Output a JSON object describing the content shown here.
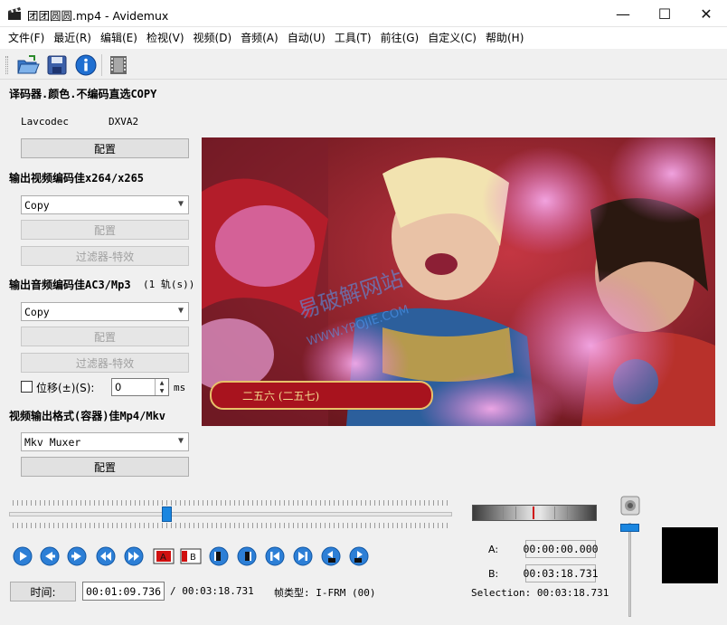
{
  "window": {
    "title": "团团圆圆.mp4 - Avidemux",
    "minimize": "—",
    "maximize": "☐",
    "close": "✕"
  },
  "menu": [
    "文件(F)",
    "最近(R)",
    "编辑(E)",
    "检视(V)",
    "视频(D)",
    "音频(A)",
    "自动(U)",
    "工具(T)",
    "前往(G)",
    "自定义(C)",
    "帮助(H)"
  ],
  "toolbar": {
    "icons": [
      "open-folder-icon",
      "save-disk-icon",
      "info-icon",
      "film-strip-icon"
    ]
  },
  "decoder": {
    "title": "译码器.颜色.不编码直选COPY",
    "lavcodec": "Lavcodec",
    "dxva": "DXVA2",
    "config": "配置"
  },
  "video_out": {
    "title": "输出视频编码佳x264/x265",
    "codec": "Copy",
    "config": "配置",
    "filters": "过滤器-特效"
  },
  "audio_out": {
    "title": "输出音频编码佳AC3/Mp3",
    "tracks": "(1 轨(s))",
    "codec": "Copy",
    "config": "配置",
    "filters": "过滤器-特效",
    "shift_label": "位移(±)(S):",
    "shift_value": "0",
    "shift_unit": "ms"
  },
  "container": {
    "title": "视频输出格式(容器)佳Mp4/Mkv",
    "muxer": "Mkv Muxer",
    "config": "配置"
  },
  "preview": {
    "banner": "二五六 (二五七)",
    "watermark_cn": "易破解网站",
    "watermark_url": "WWW.YPOJIE.COM"
  },
  "playback": {
    "position_fraction": 0.357,
    "volume_fraction": 0.04
  },
  "bottom": {
    "time_btn": "时间:",
    "current_time": "00:01:09.736",
    "total_time": "/ 00:03:18.731",
    "frame_type": "帧类型: I-FRM (00)",
    "a_label": "A:",
    "a_value": "00:00:00.000",
    "b_label": "B:",
    "b_value": "00:03:18.731",
    "selection": "Selection: 00:03:18.731"
  },
  "colors": {
    "accent_blue": "#1f6fd1",
    "slider_thumb": "#1a86e0",
    "marker_red": "#d01010"
  }
}
